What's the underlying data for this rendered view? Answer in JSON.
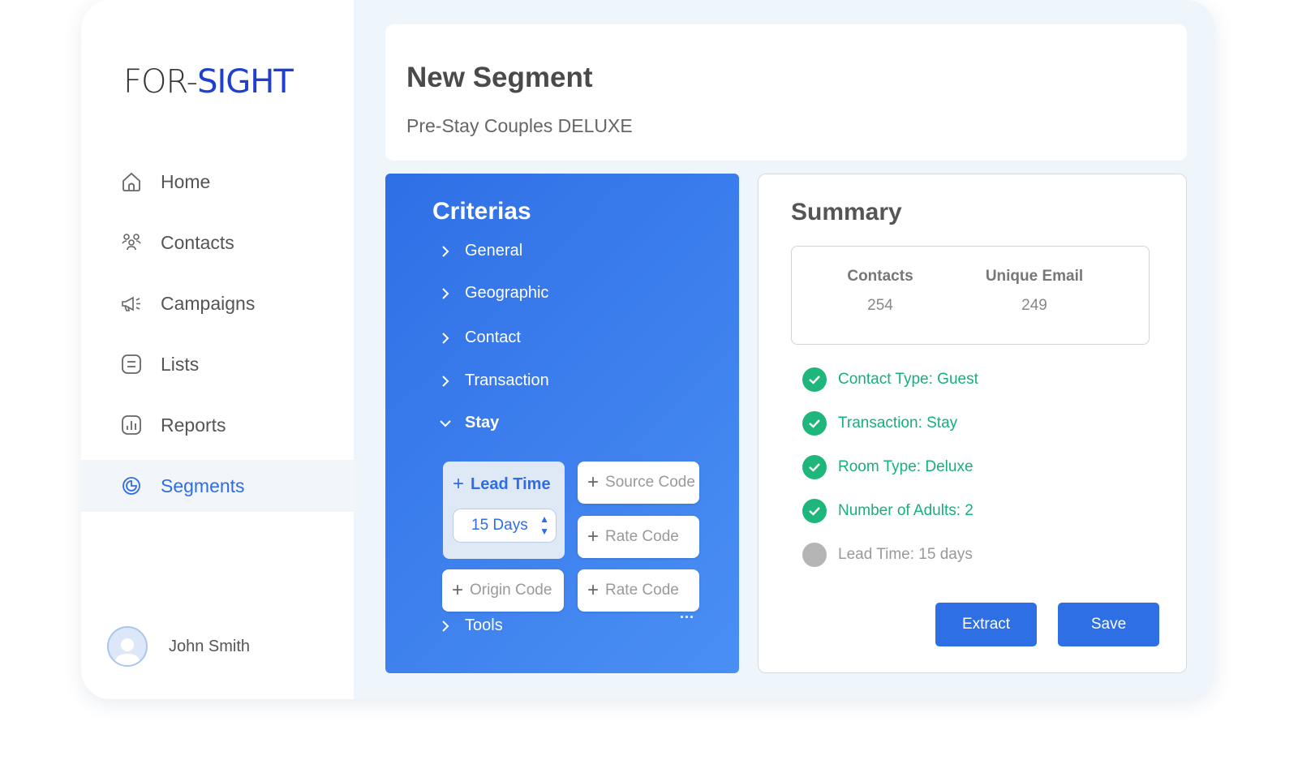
{
  "brand": {
    "logo_left": "FOR-",
    "logo_right": "SIGHT"
  },
  "sidebar": {
    "items": [
      {
        "label": "Home",
        "icon": "home-icon"
      },
      {
        "label": "Contacts",
        "icon": "contacts-icon"
      },
      {
        "label": "Campaigns",
        "icon": "megaphone-icon"
      },
      {
        "label": "Lists",
        "icon": "list-icon"
      },
      {
        "label": "Reports",
        "icon": "reports-icon"
      },
      {
        "label": "Segments",
        "icon": "segments-icon",
        "active": true
      }
    ],
    "user": {
      "name": "John Smith"
    }
  },
  "header": {
    "title": "New Segment",
    "subtitle": "Pre-Stay Couples DELUXE"
  },
  "criteria": {
    "title": "Criterias",
    "items": [
      "General",
      "Geographic",
      "Contact",
      "Transaction",
      "Stay",
      "Tools"
    ],
    "stay": {
      "lead_time_label": "Lead Time",
      "lead_time_value": "15 Days",
      "chips": [
        "Source Code",
        "Rate Code",
        "Origin Code",
        "Rate Code"
      ]
    },
    "more": "..."
  },
  "summary": {
    "title": "Summary",
    "stats": [
      {
        "label": "Contacts",
        "value": "254"
      },
      {
        "label": "Unique Email",
        "value": "249"
      }
    ],
    "checks": [
      {
        "text": "Contact Type: Guest",
        "done": true
      },
      {
        "text": "Transaction: Stay",
        "done": true
      },
      {
        "text": "Room Type: Deluxe",
        "done": true
      },
      {
        "text": "Number of Adults: 2",
        "done": true
      },
      {
        "text": "Lead Time: 15 days",
        "done": false
      }
    ],
    "extract_label": "Extract",
    "save_label": "Save"
  },
  "colors": {
    "accent": "#2f6fe6",
    "success": "#1fb67c",
    "pending": "#b5b5b5"
  }
}
